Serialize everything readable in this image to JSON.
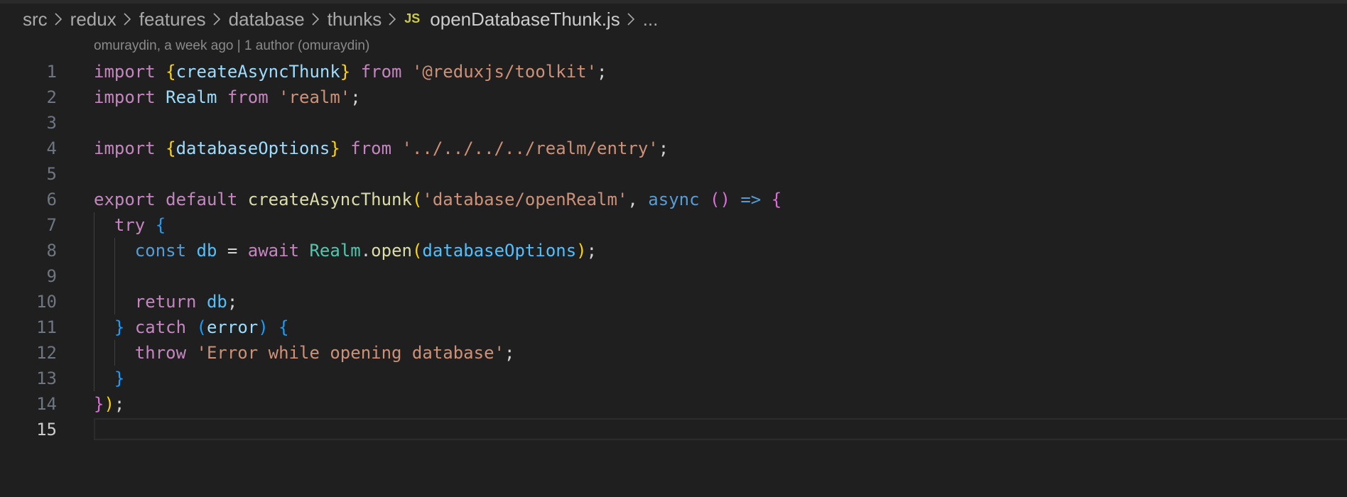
{
  "breadcrumb": {
    "items": [
      "src",
      "redux",
      "features",
      "database",
      "thunks"
    ],
    "file_icon": "JS",
    "file_name": "openDatabaseThunk.js",
    "ellipsis": "..."
  },
  "blame": {
    "text": "omuraydin, a week ago | 1 author (omuraydin)"
  },
  "editor": {
    "current_line": 15,
    "lines": [
      {
        "n": "1",
        "indent": 0,
        "tokens": [
          [
            "kw",
            "import"
          ],
          [
            "pn",
            " "
          ],
          [
            "br1",
            "{"
          ],
          [
            "vr",
            "createAsyncThunk"
          ],
          [
            "br1",
            "}"
          ],
          [
            "pn",
            " "
          ],
          [
            "kw",
            "from"
          ],
          [
            "pn",
            " "
          ],
          [
            "str",
            "'@reduxjs/toolkit'"
          ],
          [
            "pn",
            ";"
          ]
        ]
      },
      {
        "n": "2",
        "indent": 0,
        "tokens": [
          [
            "kw",
            "import"
          ],
          [
            "pn",
            " "
          ],
          [
            "vr",
            "Realm"
          ],
          [
            "pn",
            " "
          ],
          [
            "kw",
            "from"
          ],
          [
            "pn",
            " "
          ],
          [
            "str",
            "'realm'"
          ],
          [
            "pn",
            ";"
          ]
        ]
      },
      {
        "n": "3",
        "indent": 0,
        "tokens": []
      },
      {
        "n": "4",
        "indent": 0,
        "tokens": [
          [
            "kw",
            "import"
          ],
          [
            "pn",
            " "
          ],
          [
            "br1",
            "{"
          ],
          [
            "vr",
            "databaseOptions"
          ],
          [
            "br1",
            "}"
          ],
          [
            "pn",
            " "
          ],
          [
            "kw",
            "from"
          ],
          [
            "pn",
            " "
          ],
          [
            "str",
            "'../../../../realm/entry'"
          ],
          [
            "pn",
            ";"
          ]
        ]
      },
      {
        "n": "5",
        "indent": 0,
        "tokens": []
      },
      {
        "n": "6",
        "indent": 0,
        "tokens": [
          [
            "kw",
            "export"
          ],
          [
            "pn",
            " "
          ],
          [
            "kw",
            "default"
          ],
          [
            "pn",
            " "
          ],
          [
            "fn",
            "createAsyncThunk"
          ],
          [
            "br1",
            "("
          ],
          [
            "str",
            "'database/openRealm'"
          ],
          [
            "pn",
            ", "
          ],
          [
            "dec",
            "async"
          ],
          [
            "pn",
            " "
          ],
          [
            "br2",
            "()"
          ],
          [
            "pn",
            " "
          ],
          [
            "dec",
            "=>"
          ],
          [
            "pn",
            " "
          ],
          [
            "br2",
            "{"
          ]
        ]
      },
      {
        "n": "7",
        "indent": 1,
        "tokens": [
          [
            "pn",
            "  "
          ],
          [
            "kw",
            "try"
          ],
          [
            "pn",
            " "
          ],
          [
            "br3",
            "{"
          ]
        ]
      },
      {
        "n": "8",
        "indent": 2,
        "tokens": [
          [
            "pn",
            "    "
          ],
          [
            "dec",
            "const"
          ],
          [
            "pn",
            " "
          ],
          [
            "cn",
            "db"
          ],
          [
            "pn",
            " = "
          ],
          [
            "kw",
            "await"
          ],
          [
            "pn",
            " "
          ],
          [
            "cls",
            "Realm"
          ],
          [
            "pn",
            "."
          ],
          [
            "fn",
            "open"
          ],
          [
            "br1",
            "("
          ],
          [
            "cn",
            "databaseOptions"
          ],
          [
            "br1",
            ")"
          ],
          [
            "pn",
            ";"
          ]
        ]
      },
      {
        "n": "9",
        "indent": 2,
        "tokens": []
      },
      {
        "n": "10",
        "indent": 2,
        "tokens": [
          [
            "pn",
            "    "
          ],
          [
            "kw",
            "return"
          ],
          [
            "pn",
            " "
          ],
          [
            "cn",
            "db"
          ],
          [
            "pn",
            ";"
          ]
        ]
      },
      {
        "n": "11",
        "indent": 1,
        "tokens": [
          [
            "pn",
            "  "
          ],
          [
            "br3",
            "}"
          ],
          [
            "pn",
            " "
          ],
          [
            "kw",
            "catch"
          ],
          [
            "pn",
            " "
          ],
          [
            "br3",
            "("
          ],
          [
            "vr",
            "error"
          ],
          [
            "br3",
            ")"
          ],
          [
            "pn",
            " "
          ],
          [
            "br3",
            "{"
          ]
        ]
      },
      {
        "n": "12",
        "indent": 2,
        "tokens": [
          [
            "pn",
            "    "
          ],
          [
            "kw",
            "throw"
          ],
          [
            "pn",
            " "
          ],
          [
            "str",
            "'Error while opening database'"
          ],
          [
            "pn",
            ";"
          ]
        ]
      },
      {
        "n": "13",
        "indent": 1,
        "tokens": [
          [
            "pn",
            "  "
          ],
          [
            "br3",
            "}"
          ]
        ]
      },
      {
        "n": "14",
        "indent": 0,
        "tokens": [
          [
            "br2",
            "}"
          ],
          [
            "br1",
            ")"
          ],
          [
            "pn",
            ";"
          ]
        ]
      },
      {
        "n": "15",
        "indent": 0,
        "tokens": []
      }
    ]
  }
}
